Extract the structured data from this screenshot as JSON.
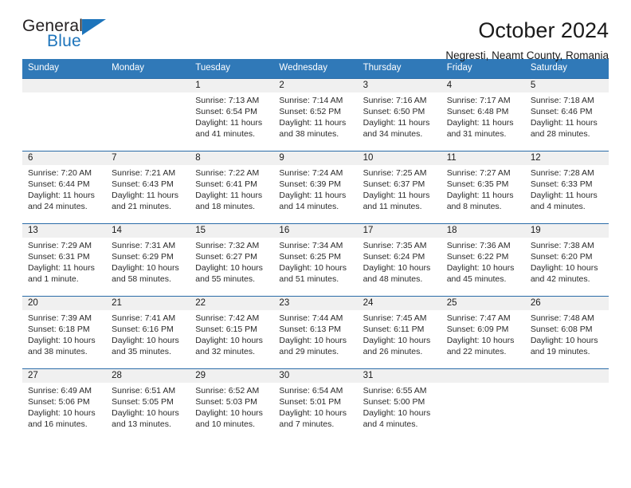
{
  "brand": {
    "name_top": "General",
    "name_bottom": "Blue",
    "triangle_color": "#1d74bb"
  },
  "header": {
    "title": "October 2024",
    "subtitle": "Negresti, Neamt County, Romania"
  },
  "theme": {
    "header_blue": "#3079b8",
    "row_rule_blue": "#2b6ca8",
    "daynum_band": "#f0f0f0"
  },
  "weekday_headers": [
    "Sunday",
    "Monday",
    "Tuesday",
    "Wednesday",
    "Thursday",
    "Friday",
    "Saturday"
  ],
  "weeks": [
    [
      {
        "day": "",
        "empty": true
      },
      {
        "day": "",
        "empty": true
      },
      {
        "day": "1",
        "sunrise": "Sunrise: 7:13 AM",
        "sunset": "Sunset: 6:54 PM",
        "daylight": "Daylight: 11 hours and 41 minutes."
      },
      {
        "day": "2",
        "sunrise": "Sunrise: 7:14 AM",
        "sunset": "Sunset: 6:52 PM",
        "daylight": "Daylight: 11 hours and 38 minutes."
      },
      {
        "day": "3",
        "sunrise": "Sunrise: 7:16 AM",
        "sunset": "Sunset: 6:50 PM",
        "daylight": "Daylight: 11 hours and 34 minutes."
      },
      {
        "day": "4",
        "sunrise": "Sunrise: 7:17 AM",
        "sunset": "Sunset: 6:48 PM",
        "daylight": "Daylight: 11 hours and 31 minutes."
      },
      {
        "day": "5",
        "sunrise": "Sunrise: 7:18 AM",
        "sunset": "Sunset: 6:46 PM",
        "daylight": "Daylight: 11 hours and 28 minutes."
      }
    ],
    [
      {
        "day": "6",
        "sunrise": "Sunrise: 7:20 AM",
        "sunset": "Sunset: 6:44 PM",
        "daylight": "Daylight: 11 hours and 24 minutes."
      },
      {
        "day": "7",
        "sunrise": "Sunrise: 7:21 AM",
        "sunset": "Sunset: 6:43 PM",
        "daylight": "Daylight: 11 hours and 21 minutes."
      },
      {
        "day": "8",
        "sunrise": "Sunrise: 7:22 AM",
        "sunset": "Sunset: 6:41 PM",
        "daylight": "Daylight: 11 hours and 18 minutes."
      },
      {
        "day": "9",
        "sunrise": "Sunrise: 7:24 AM",
        "sunset": "Sunset: 6:39 PM",
        "daylight": "Daylight: 11 hours and 14 minutes."
      },
      {
        "day": "10",
        "sunrise": "Sunrise: 7:25 AM",
        "sunset": "Sunset: 6:37 PM",
        "daylight": "Daylight: 11 hours and 11 minutes."
      },
      {
        "day": "11",
        "sunrise": "Sunrise: 7:27 AM",
        "sunset": "Sunset: 6:35 PM",
        "daylight": "Daylight: 11 hours and 8 minutes."
      },
      {
        "day": "12",
        "sunrise": "Sunrise: 7:28 AM",
        "sunset": "Sunset: 6:33 PM",
        "daylight": "Daylight: 11 hours and 4 minutes."
      }
    ],
    [
      {
        "day": "13",
        "sunrise": "Sunrise: 7:29 AM",
        "sunset": "Sunset: 6:31 PM",
        "daylight": "Daylight: 11 hours and 1 minute."
      },
      {
        "day": "14",
        "sunrise": "Sunrise: 7:31 AM",
        "sunset": "Sunset: 6:29 PM",
        "daylight": "Daylight: 10 hours and 58 minutes."
      },
      {
        "day": "15",
        "sunrise": "Sunrise: 7:32 AM",
        "sunset": "Sunset: 6:27 PM",
        "daylight": "Daylight: 10 hours and 55 minutes."
      },
      {
        "day": "16",
        "sunrise": "Sunrise: 7:34 AM",
        "sunset": "Sunset: 6:25 PM",
        "daylight": "Daylight: 10 hours and 51 minutes."
      },
      {
        "day": "17",
        "sunrise": "Sunrise: 7:35 AM",
        "sunset": "Sunset: 6:24 PM",
        "daylight": "Daylight: 10 hours and 48 minutes."
      },
      {
        "day": "18",
        "sunrise": "Sunrise: 7:36 AM",
        "sunset": "Sunset: 6:22 PM",
        "daylight": "Daylight: 10 hours and 45 minutes."
      },
      {
        "day": "19",
        "sunrise": "Sunrise: 7:38 AM",
        "sunset": "Sunset: 6:20 PM",
        "daylight": "Daylight: 10 hours and 42 minutes."
      }
    ],
    [
      {
        "day": "20",
        "sunrise": "Sunrise: 7:39 AM",
        "sunset": "Sunset: 6:18 PM",
        "daylight": "Daylight: 10 hours and 38 minutes."
      },
      {
        "day": "21",
        "sunrise": "Sunrise: 7:41 AM",
        "sunset": "Sunset: 6:16 PM",
        "daylight": "Daylight: 10 hours and 35 minutes."
      },
      {
        "day": "22",
        "sunrise": "Sunrise: 7:42 AM",
        "sunset": "Sunset: 6:15 PM",
        "daylight": "Daylight: 10 hours and 32 minutes."
      },
      {
        "day": "23",
        "sunrise": "Sunrise: 7:44 AM",
        "sunset": "Sunset: 6:13 PM",
        "daylight": "Daylight: 10 hours and 29 minutes."
      },
      {
        "day": "24",
        "sunrise": "Sunrise: 7:45 AM",
        "sunset": "Sunset: 6:11 PM",
        "daylight": "Daylight: 10 hours and 26 minutes."
      },
      {
        "day": "25",
        "sunrise": "Sunrise: 7:47 AM",
        "sunset": "Sunset: 6:09 PM",
        "daylight": "Daylight: 10 hours and 22 minutes."
      },
      {
        "day": "26",
        "sunrise": "Sunrise: 7:48 AM",
        "sunset": "Sunset: 6:08 PM",
        "daylight": "Daylight: 10 hours and 19 minutes."
      }
    ],
    [
      {
        "day": "27",
        "sunrise": "Sunrise: 6:49 AM",
        "sunset": "Sunset: 5:06 PM",
        "daylight": "Daylight: 10 hours and 16 minutes."
      },
      {
        "day": "28",
        "sunrise": "Sunrise: 6:51 AM",
        "sunset": "Sunset: 5:05 PM",
        "daylight": "Daylight: 10 hours and 13 minutes."
      },
      {
        "day": "29",
        "sunrise": "Sunrise: 6:52 AM",
        "sunset": "Sunset: 5:03 PM",
        "daylight": "Daylight: 10 hours and 10 minutes."
      },
      {
        "day": "30",
        "sunrise": "Sunrise: 6:54 AM",
        "sunset": "Sunset: 5:01 PM",
        "daylight": "Daylight: 10 hours and 7 minutes."
      },
      {
        "day": "31",
        "sunrise": "Sunrise: 6:55 AM",
        "sunset": "Sunset: 5:00 PM",
        "daylight": "Daylight: 10 hours and 4 minutes."
      },
      {
        "day": "",
        "empty": true
      },
      {
        "day": "",
        "empty": true
      }
    ]
  ]
}
